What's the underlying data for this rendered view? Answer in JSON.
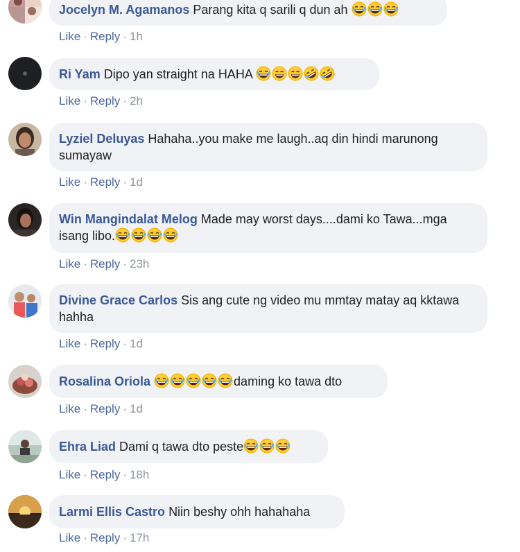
{
  "comments": [
    {
      "name": "Jocelyn M. Agamanos",
      "text": "Parang kita q sarili q dun ah ",
      "emoji": [
        "laughing",
        "laughing",
        "laughing"
      ],
      "like": "Like",
      "reply": "Reply",
      "sep": "·",
      "time": "1h",
      "avatar": "avatar-photo-group"
    },
    {
      "name": "Ri Yam",
      "text": "Dipo yan straight na HAHA ",
      "emoji": [
        "laughing",
        "smiling",
        "smiling",
        "rofl",
        "rofl"
      ],
      "like": "Like",
      "reply": "Reply",
      "sep": "·",
      "time": "2h",
      "avatar": "avatar-dark-circle"
    },
    {
      "name": "Lyziel Deluyas",
      "text": "Hahaha..you make me laugh..aq din hindi marunong sumayaw",
      "emoji": [],
      "like": "Like",
      "reply": "Reply",
      "sep": "·",
      "time": "1d",
      "avatar": "avatar-photo-woman"
    },
    {
      "name": "Win Mangindalat Melog",
      "text": "Made may worst days....dami ko Tawa...mga isang libo.",
      "emoji": [
        "laughing",
        "laughing",
        "laughing",
        "laughing"
      ],
      "like": "Like",
      "reply": "Reply",
      "sep": "·",
      "time": "23h",
      "avatar": "avatar-photo-woman-dark"
    },
    {
      "name": "Divine Grace Carlos",
      "text": "Sis ang cute ng video mu mmtay matay aq kktawa hahha",
      "emoji": [],
      "like": "Like",
      "reply": "Reply",
      "sep": "·",
      "time": "1d",
      "avatar": "avatar-photo-family"
    },
    {
      "name": "Rosalina Oriola",
      "text": "daming ko tawa dto",
      "emoji_before": [
        "laughing",
        "laughing",
        "laughing",
        "laughing",
        "laughing"
      ],
      "emoji": [],
      "like": "Like",
      "reply": "Reply",
      "sep": "·",
      "time": "1d",
      "avatar": "avatar-photo-flowers"
    },
    {
      "name": "Ehra Liad",
      "text": "Dami q tawa dto peste",
      "emoji": [
        "laughing",
        "laughing",
        "laughing"
      ],
      "like": "Like",
      "reply": "Reply",
      "sep": "·",
      "time": "18h",
      "avatar": "avatar-photo-outdoor"
    },
    {
      "name": "Larmi Ellis Castro",
      "text": "Niin beshy ohh hahahaha",
      "emoji": [],
      "like": "Like",
      "reply": "Reply",
      "sep": "·",
      "time": "17h",
      "avatar": "avatar-photo-sunset"
    }
  ],
  "colors": {
    "name": "#385898",
    "bubble": "#f0f2f5",
    "action_link": "#4b67a1",
    "meta": "#8d949e",
    "emoji_face": "#f7b500"
  }
}
